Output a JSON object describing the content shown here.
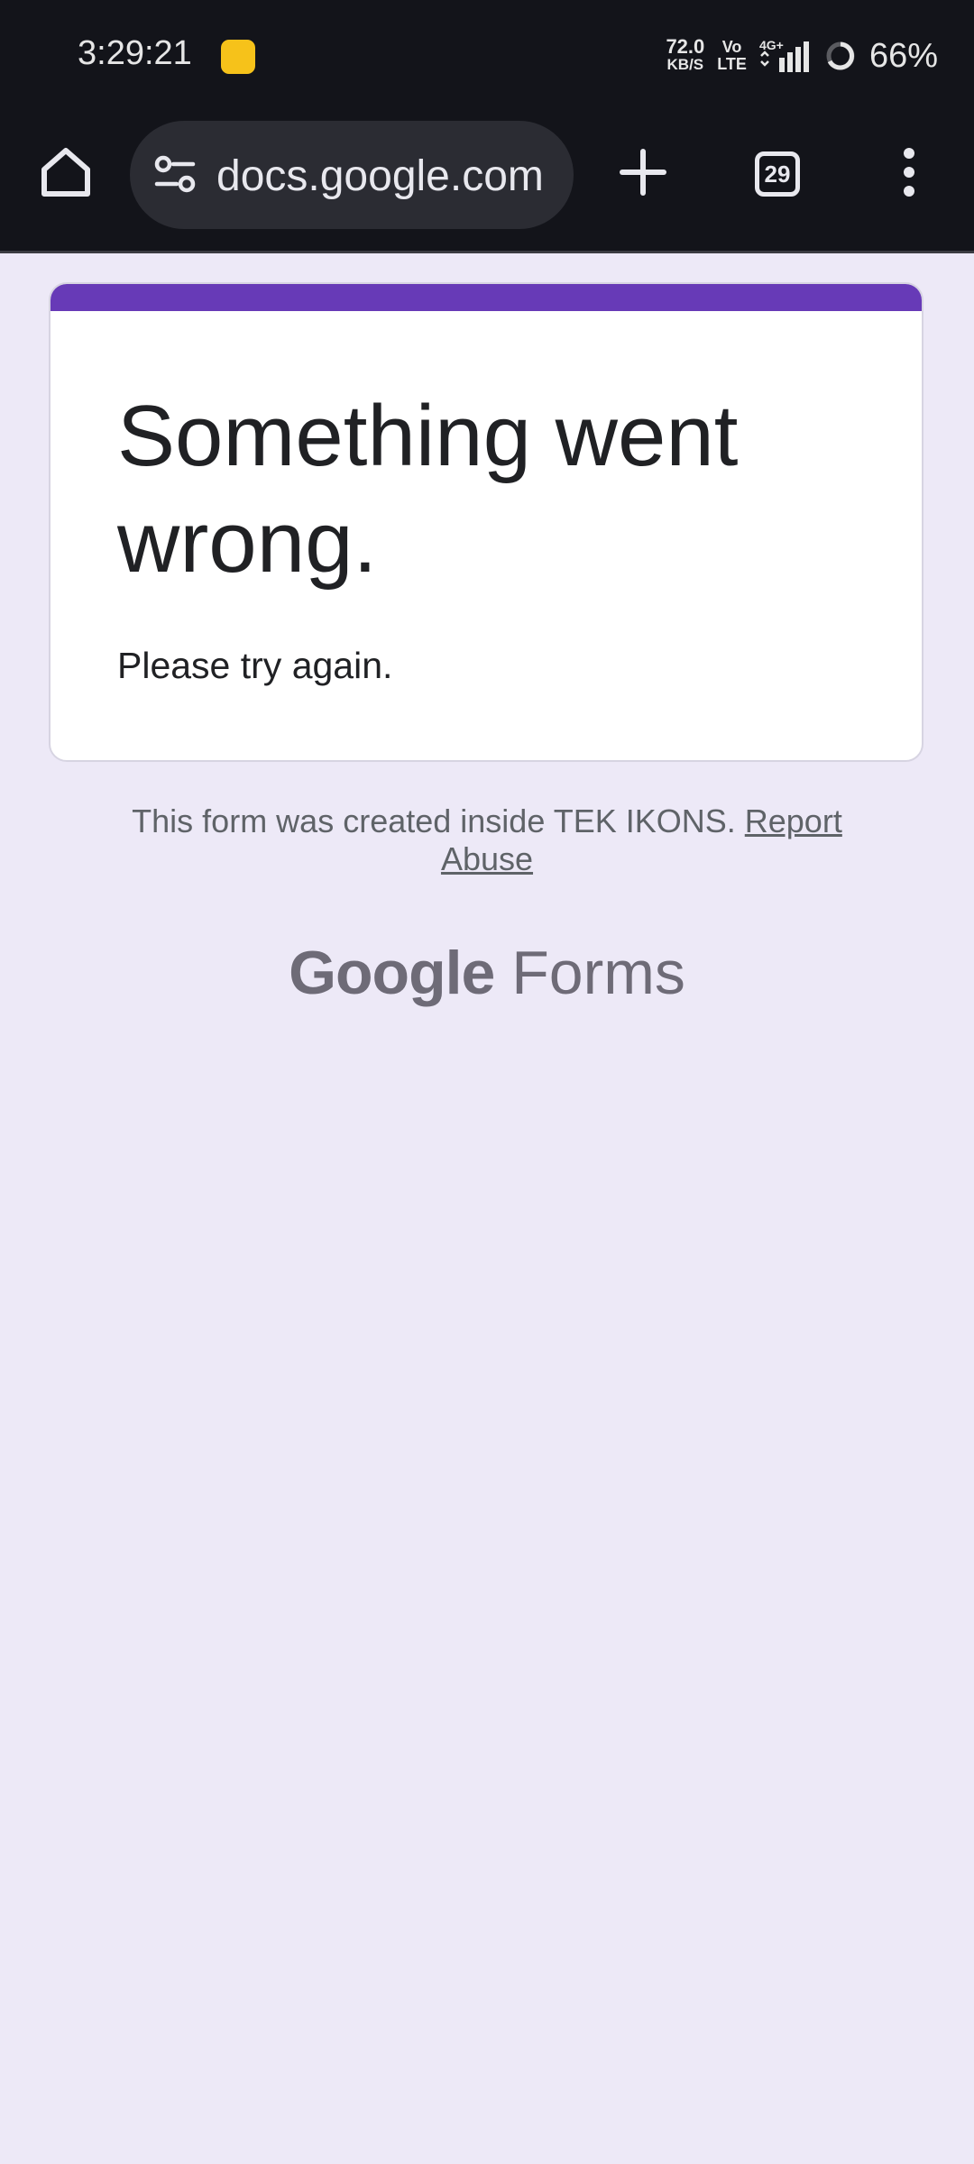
{
  "status_bar": {
    "time": "3:29:21",
    "app_icon": "realme-app-icon",
    "net_speed_value": "72.0",
    "net_speed_unit": "KB/S",
    "volte_top": "Vo",
    "volte_bottom": "LTE",
    "network": "4G+",
    "battery": "66%"
  },
  "browser": {
    "url": "docs.google.com",
    "tab_count": "29",
    "icons": [
      "home-icon",
      "site-settings-icon",
      "plus-icon",
      "tabs-icon",
      "more-vert-icon"
    ]
  },
  "error_card": {
    "title": "Something went wrong.",
    "message": "Please try again."
  },
  "footer": {
    "note": "This form was created inside TEK IKONS.",
    "report_link": "Report Abuse"
  },
  "brand": {
    "google": "Google",
    "product": "Forms"
  },
  "colors": {
    "accent": "#673ab7",
    "page_background": "#ede9f7",
    "chrome_background": "#13141a"
  }
}
